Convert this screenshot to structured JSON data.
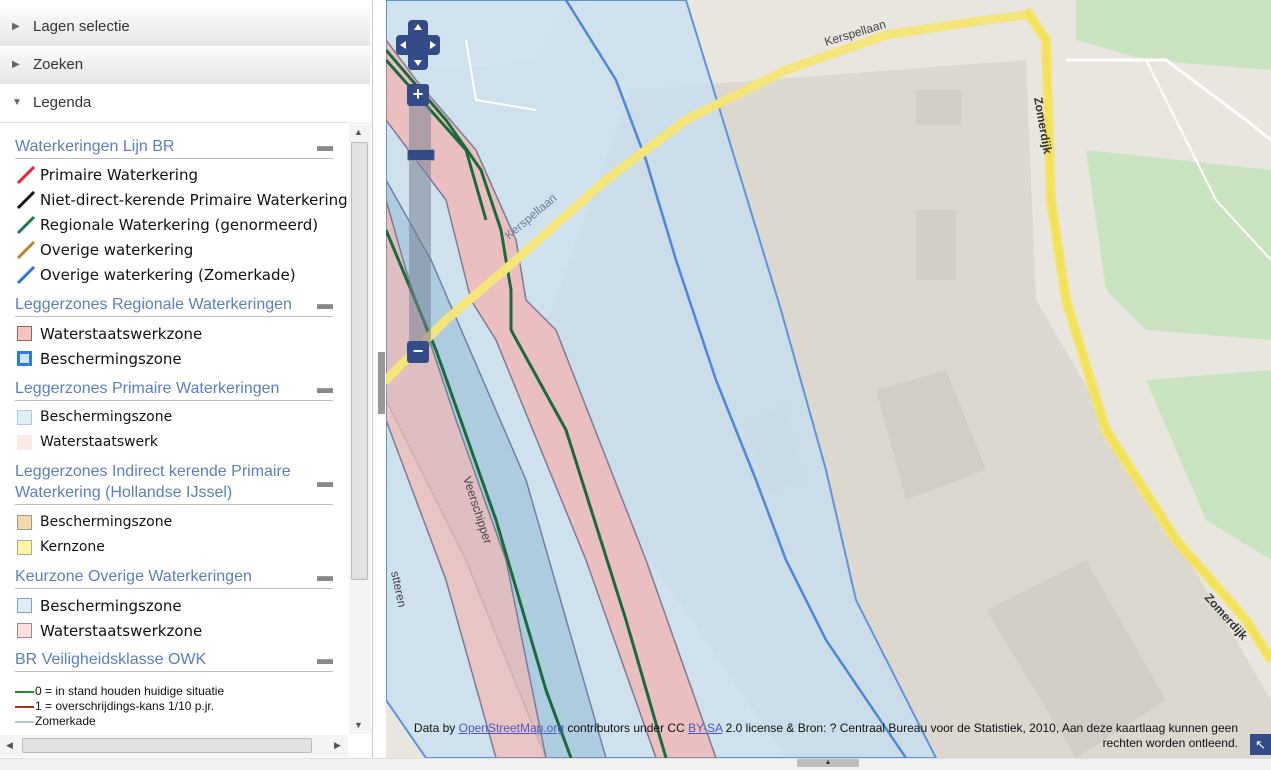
{
  "sidebar": {
    "panels": [
      {
        "label": "Lagen selectie",
        "expanded": false
      },
      {
        "label": "Zoeken",
        "expanded": false
      },
      {
        "label": "Legenda",
        "expanded": true
      }
    ]
  },
  "legend": {
    "sections": [
      {
        "title": "Waterkeringen Lijn BR",
        "items": [
          {
            "label": "Primaire Waterkering",
            "color": "#e8202a"
          },
          {
            "label": "Niet-direct-kerende Primaire Waterkering",
            "color": "#111111"
          },
          {
            "label": "Regionale Waterkering (genormeerd)",
            "color": "#16794a"
          },
          {
            "label": "Overige waterkering",
            "color": "#b7862b"
          },
          {
            "label": "Overige waterkering (Zomerkade)",
            "color": "#2f71d8"
          }
        ]
      },
      {
        "title": "Leggerzones Regionale Waterkeringen",
        "items": [
          {
            "label": "Waterstaatswerkzone",
            "fill": "#f6c3c1",
            "border": "#8b6666"
          },
          {
            "label": "Beschermingszone",
            "fill": "#cfe4f7",
            "border": "#2a7fd8"
          }
        ]
      },
      {
        "title": "Leggerzones Primaire Waterkeringen",
        "items": [
          {
            "label": "Beschermingszone",
            "fill": "#deeff8",
            "border": "#b9c9d6"
          },
          {
            "label": "Waterstaatswerk",
            "fill": "#fde8e8",
            "border": "#fde8e8"
          }
        ]
      },
      {
        "title": "Leggerzones Indirect kerende Primaire Waterkering (Hollandse IJssel)",
        "items": [
          {
            "label": "Beschermingszone",
            "fill": "#f5d8a8",
            "border": "#a59a8a"
          },
          {
            "label": "Kernzone",
            "fill": "#fbf5a4",
            "border": "#b0ac8a"
          }
        ]
      },
      {
        "title": "Keurzone Overige Waterkeringen",
        "items": [
          {
            "label": "Beschermingszone",
            "fill": "#dceefb",
            "border": "#8aa0b3"
          },
          {
            "label": "Waterstaatswerkzone",
            "fill": "#fbdede",
            "border": "#9a8a8a"
          }
        ]
      },
      {
        "title": "BR Veiligheidsklasse OWK",
        "items": [
          {
            "label": "0 = in stand houden huidige situatie",
            "color": "#1f8b1f"
          },
          {
            "label": "1 = overschrijdings-kans 1/10 p.jr.",
            "color": "#a0341a"
          },
          {
            "label": "Zomerkade",
            "color": "#b7c7e8"
          }
        ]
      }
    ]
  },
  "map": {
    "streets": {
      "kerspellaan_top": "Kerspellaan",
      "kerspellaan_mid": "Kerspellaan",
      "zomerdijk_top": "Zomerdijk",
      "zomerdijk_bottom": "Zomerdijk",
      "veerschipper": "Veerschipper",
      "partial": "stteren"
    },
    "zoom": {
      "plus": "+",
      "minus": "−"
    },
    "attribution": {
      "prefix": "Data by ",
      "osm_link": "OpenStreetMap.org",
      "mid1": " contributors under CC ",
      "license_link": "BY-SA",
      "mid2": " 2.0 license & Bron: ? Centraal Bureau voor de Statistiek, 2010, Aan deze kaartlaag kunnen geen rechten worden ontleend."
    },
    "expand_icon": "↖"
  }
}
